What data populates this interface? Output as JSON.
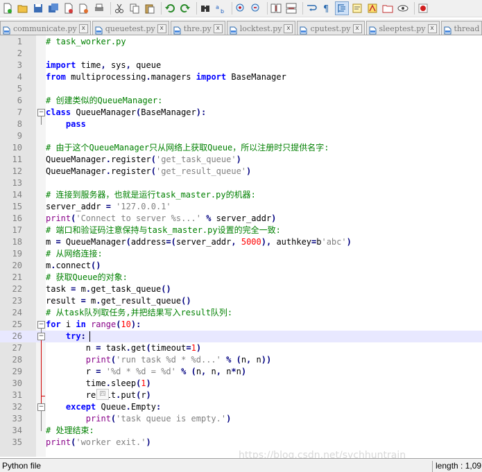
{
  "toolbar": {
    "icons": [
      "new-file-icon",
      "open-file-icon",
      "save-icon",
      "save-all-icon",
      "close-icon",
      "close-all-icon",
      "print-icon",
      "cut-icon",
      "copy-icon",
      "paste-icon",
      "undo-icon",
      "redo-icon",
      "find-icon",
      "replace-icon",
      "zoom-in-icon",
      "zoom-out-icon",
      "sync-vertical-icon",
      "sync-horizontal-icon",
      "word-wrap-icon",
      "show-all-chars-icon",
      "indent-guide-icon",
      "document-map-icon",
      "function-list-icon",
      "folder-workspace-icon",
      "monitoring-icon",
      "record-macro-icon"
    ]
  },
  "tabs": [
    {
      "label": "communicate.py"
    },
    {
      "label": "queuetest.py"
    },
    {
      "label": "thre.py"
    },
    {
      "label": "locktest.py"
    },
    {
      "label": "cputest.py"
    },
    {
      "label": "sleeptest.py"
    },
    {
      "label": "thread"
    }
  ],
  "tab_close_glyph": "x",
  "editor": {
    "current_line": 26,
    "lines": [
      {
        "n": "1",
        "t": "# task_worker.py"
      },
      {
        "n": "2",
        "t": ""
      },
      {
        "n": "3",
        "t": "import time, sys, queue"
      },
      {
        "n": "4",
        "t": "from multiprocessing.managers import BaseManager"
      },
      {
        "n": "5",
        "t": ""
      },
      {
        "n": "6",
        "t": "# 创建类似的QueueManager:"
      },
      {
        "n": "7",
        "t": "class QueueManager(BaseManager):"
      },
      {
        "n": "8",
        "t": "    pass"
      },
      {
        "n": "9",
        "t": ""
      },
      {
        "n": "10",
        "t": "# 由于这个QueueManager只从网络上获取Queue，所以注册时只提供名字:"
      },
      {
        "n": "11",
        "t": "QueueManager.register('get_task_queue')"
      },
      {
        "n": "12",
        "t": "QueueManager.register('get_result_queue')"
      },
      {
        "n": "13",
        "t": ""
      },
      {
        "n": "14",
        "t": "# 连接到服务器，也就是运行task_master.py的机器:"
      },
      {
        "n": "15",
        "t": "server_addr = '127.0.0.1'"
      },
      {
        "n": "16",
        "t": "print('Connect to server %s...' % server_addr)"
      },
      {
        "n": "17",
        "t": "# 端口和验证码注意保持与task_master.py设置的完全一致:"
      },
      {
        "n": "18",
        "t": "m = QueueManager(address=(server_addr, 5000), authkey=b'abc')"
      },
      {
        "n": "19",
        "t": "# 从网络连接:"
      },
      {
        "n": "20",
        "t": "m.connect()"
      },
      {
        "n": "21",
        "t": "# 获取Queue的对象:"
      },
      {
        "n": "22",
        "t": "task = m.get_task_queue()"
      },
      {
        "n": "23",
        "t": "result = m.get_result_queue()"
      },
      {
        "n": "24",
        "t": "# 从task队列取任务,并把结果写入result队列:"
      },
      {
        "n": "25",
        "t": "for i in range(10):"
      },
      {
        "n": "26",
        "t": "    try:"
      },
      {
        "n": "27",
        "t": "        n = task.get(timeout=1)"
      },
      {
        "n": "28",
        "t": "        print('run task %d * %d...' % (n, n))"
      },
      {
        "n": "29",
        "t": "        r = '%d * %d = %d' % (n, n, n*n)"
      },
      {
        "n": "30",
        "t": "        time.sleep(1)"
      },
      {
        "n": "31",
        "t": "        result.put(r)"
      },
      {
        "n": "32",
        "t": "    except Queue.Empty:"
      },
      {
        "n": "33",
        "t": "        print('task queue is empty.')"
      },
      {
        "n": "34",
        "t": "# 处理结束:"
      },
      {
        "n": "35",
        "t": "print('worker exit.')"
      }
    ]
  },
  "ime_hint": "四",
  "watermark": "https://blog.csdn.net/sychhuntrain",
  "status": {
    "file_type": "Python file",
    "length": "length : 1,09"
  }
}
